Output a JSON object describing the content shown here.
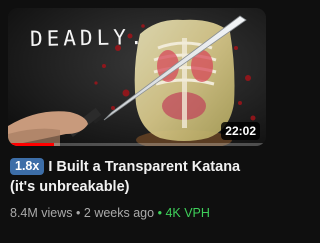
{
  "thumbnail": {
    "overlay_text": "DEADLY.",
    "duration": "22:02",
    "progress_fraction": 0.18,
    "progress_color": "#ff0000"
  },
  "video": {
    "speed_badge": "1.8x",
    "badge_color": "#3d6ea8",
    "title": "I Built a Transparent Katana (it's unbreakable)"
  },
  "meta": {
    "views": "8.4M views",
    "age": "2 weeks ago",
    "vph": "4K VPH",
    "separator": "•",
    "vph_color": "#3ecf5a"
  }
}
